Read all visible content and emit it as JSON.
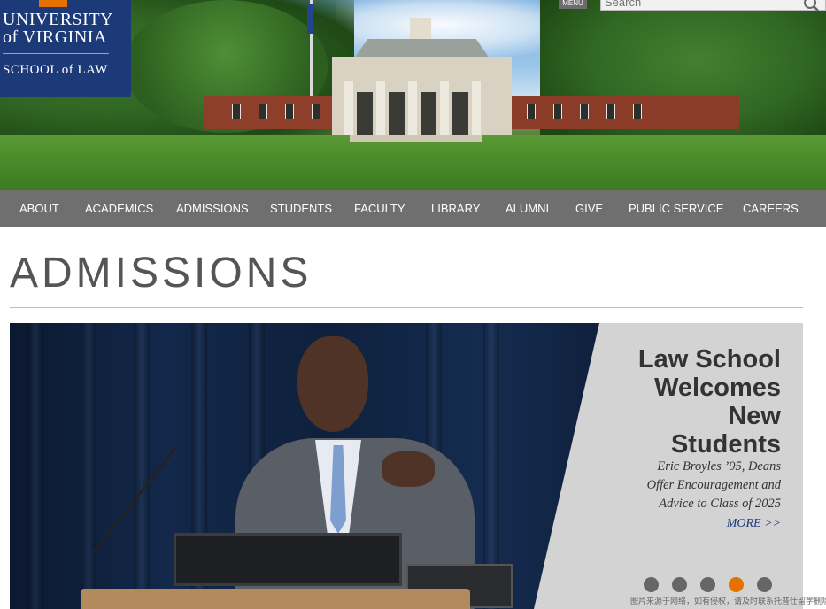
{
  "header": {
    "logo": {
      "line1": "UNIVERSITY",
      "line2": "of VIRGINIA",
      "line3": "SCHOOL of LAW"
    },
    "menu_label": "MENU",
    "search": {
      "placeholder": "Search",
      "icon": "search-icon"
    }
  },
  "nav": {
    "items": [
      {
        "label": "ABOUT"
      },
      {
        "label": "ACADEMICS"
      },
      {
        "label": "ADMISSIONS"
      },
      {
        "label": "STUDENTS"
      },
      {
        "label": "FACULTY"
      },
      {
        "label": "LIBRARY"
      },
      {
        "label": "ALUMNI"
      },
      {
        "label": "GIVE"
      },
      {
        "label": "PUBLIC SERVICE"
      },
      {
        "label": "CAREERS"
      }
    ]
  },
  "page": {
    "title": "ADMISSIONS"
  },
  "slider": {
    "headline_lines": [
      "Law School",
      "Welcomes",
      "New",
      "Students"
    ],
    "subhead_lines": [
      "Eric Broyles ’95, Deans",
      "Offer Encouragement and",
      "Advice to Class of 2025"
    ],
    "more_label": "MORE >>",
    "slide_count": 5,
    "active_slide_index": 3
  },
  "watermark": "图片来源于网络，如有侵权，请及时联系托普仕留学删除",
  "colors": {
    "uva_navy": "#1c3a78",
    "uva_orange": "#e57200",
    "nav_gray": "#6f6f6f",
    "title_gray": "#555555",
    "caption_panel": "#d3d3d3"
  }
}
